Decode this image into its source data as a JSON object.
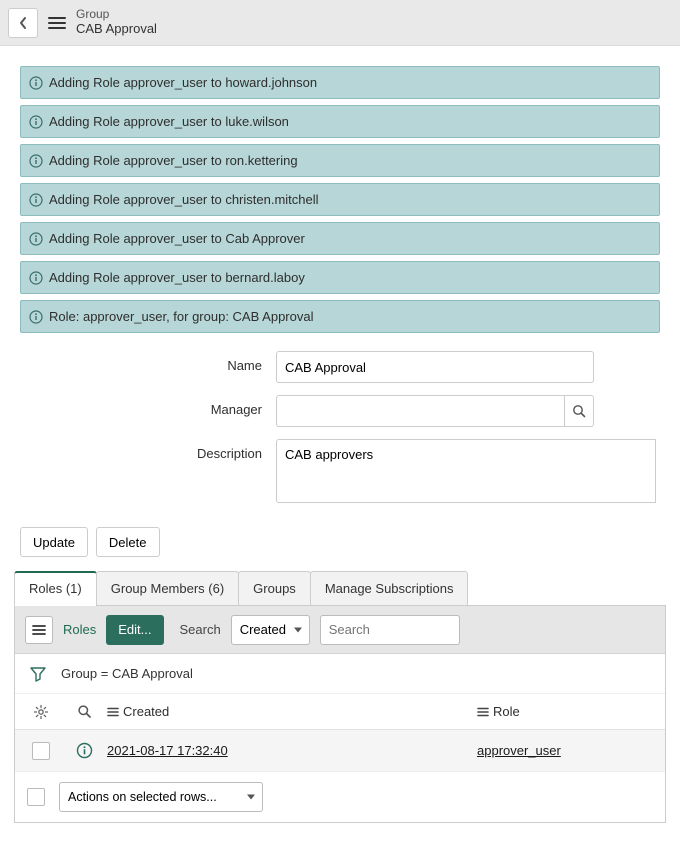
{
  "header": {
    "type_label": "Group",
    "record_name": "CAB Approval"
  },
  "notices": [
    "Adding Role approver_user to howard.johnson",
    "Adding Role approver_user to luke.wilson",
    "Adding Role approver_user to ron.kettering",
    "Adding Role approver_user to christen.mitchell",
    "Adding Role approver_user to Cab Approver",
    "Adding Role approver_user to bernard.laboy",
    "Role: approver_user, for group: CAB Approval"
  ],
  "form": {
    "labels": {
      "name": "Name",
      "manager": "Manager",
      "description": "Description"
    },
    "values": {
      "name": "CAB Approval",
      "manager": "",
      "description": "CAB approvers"
    }
  },
  "actions": {
    "update": "Update",
    "delete": "Delete"
  },
  "tabs": {
    "items": [
      {
        "label": "Roles (1)",
        "active": true
      },
      {
        "label": "Group Members (6)",
        "active": false
      },
      {
        "label": "Groups",
        "active": false
      },
      {
        "label": "Manage Subscriptions",
        "active": false
      }
    ]
  },
  "list": {
    "title": "Roles",
    "edit_btn": "Edit...",
    "search_label": "Search",
    "search_field_selected": "Created",
    "search_placeholder": "Search",
    "filter_text": "Group = CAB Approval",
    "columns": {
      "created": "Created",
      "role": "Role"
    },
    "rows": [
      {
        "created": "2021-08-17 17:32:40",
        "role": "approver_user"
      }
    ],
    "footer_action_placeholder": "Actions on selected rows..."
  }
}
